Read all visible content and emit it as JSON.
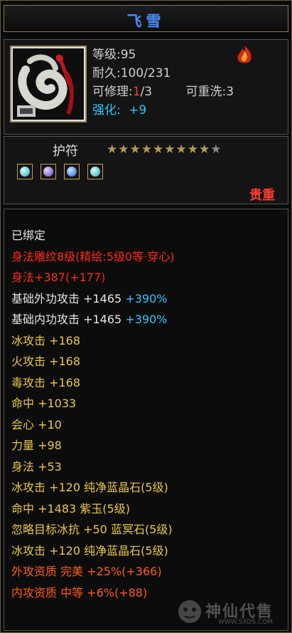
{
  "item": {
    "name": "飞雪"
  },
  "header": {
    "level": "等级:95",
    "durability_label": "耐久:100/231",
    "repair_label": "可修理:",
    "repair_current": "1",
    "repair_max": "/3",
    "reforge": "可重洗:3",
    "enhance_label": "强化:",
    "enhance_value": "+9"
  },
  "amulet": {
    "label": "护符",
    "stars_filled": 9,
    "stars_total": 10,
    "gems": [
      "teal-gem-icon",
      "purple-gem-icon",
      "blue-gem-icon",
      "teal-gem-icon"
    ],
    "rarity": "贵重"
  },
  "stats": {
    "bound": "已绑定",
    "engrave": "身法雕纹8级(精绘:5级0等·穿心)",
    "agility_bonus": "身法+387(+177)",
    "base_outer_attack": "基础外功攻击 +1465",
    "base_outer_attack_pct": "+390%",
    "base_inner_attack": "基础内功攻击 +1465",
    "base_inner_attack_pct": "+390%",
    "ice_attack": "冰攻击 +168",
    "fire_attack": "火攻击 +168",
    "poison_attack": "毒攻击 +168",
    "hit": "命中 +1033",
    "crit": "会心 +10",
    "strength": "力量 +98",
    "agility": "身法 +53",
    "gem1": "冰攻击 +120 纯净蓝晶石(5级)",
    "gem2": "命中 +1483 紫玉(5级)",
    "gem3": "忽略目标冰抗 +50 蓝冥石(5级)",
    "gem4": "冰攻击 +120 纯净蓝晶石(5级)",
    "outer_quality": "外攻资质  完美 +25%(+366)",
    "inner_quality": "内攻资质  中等 +6%(+88)"
  },
  "watermark": {
    "text": "神仙代售",
    "url": "WWW.SXDS.COM"
  }
}
